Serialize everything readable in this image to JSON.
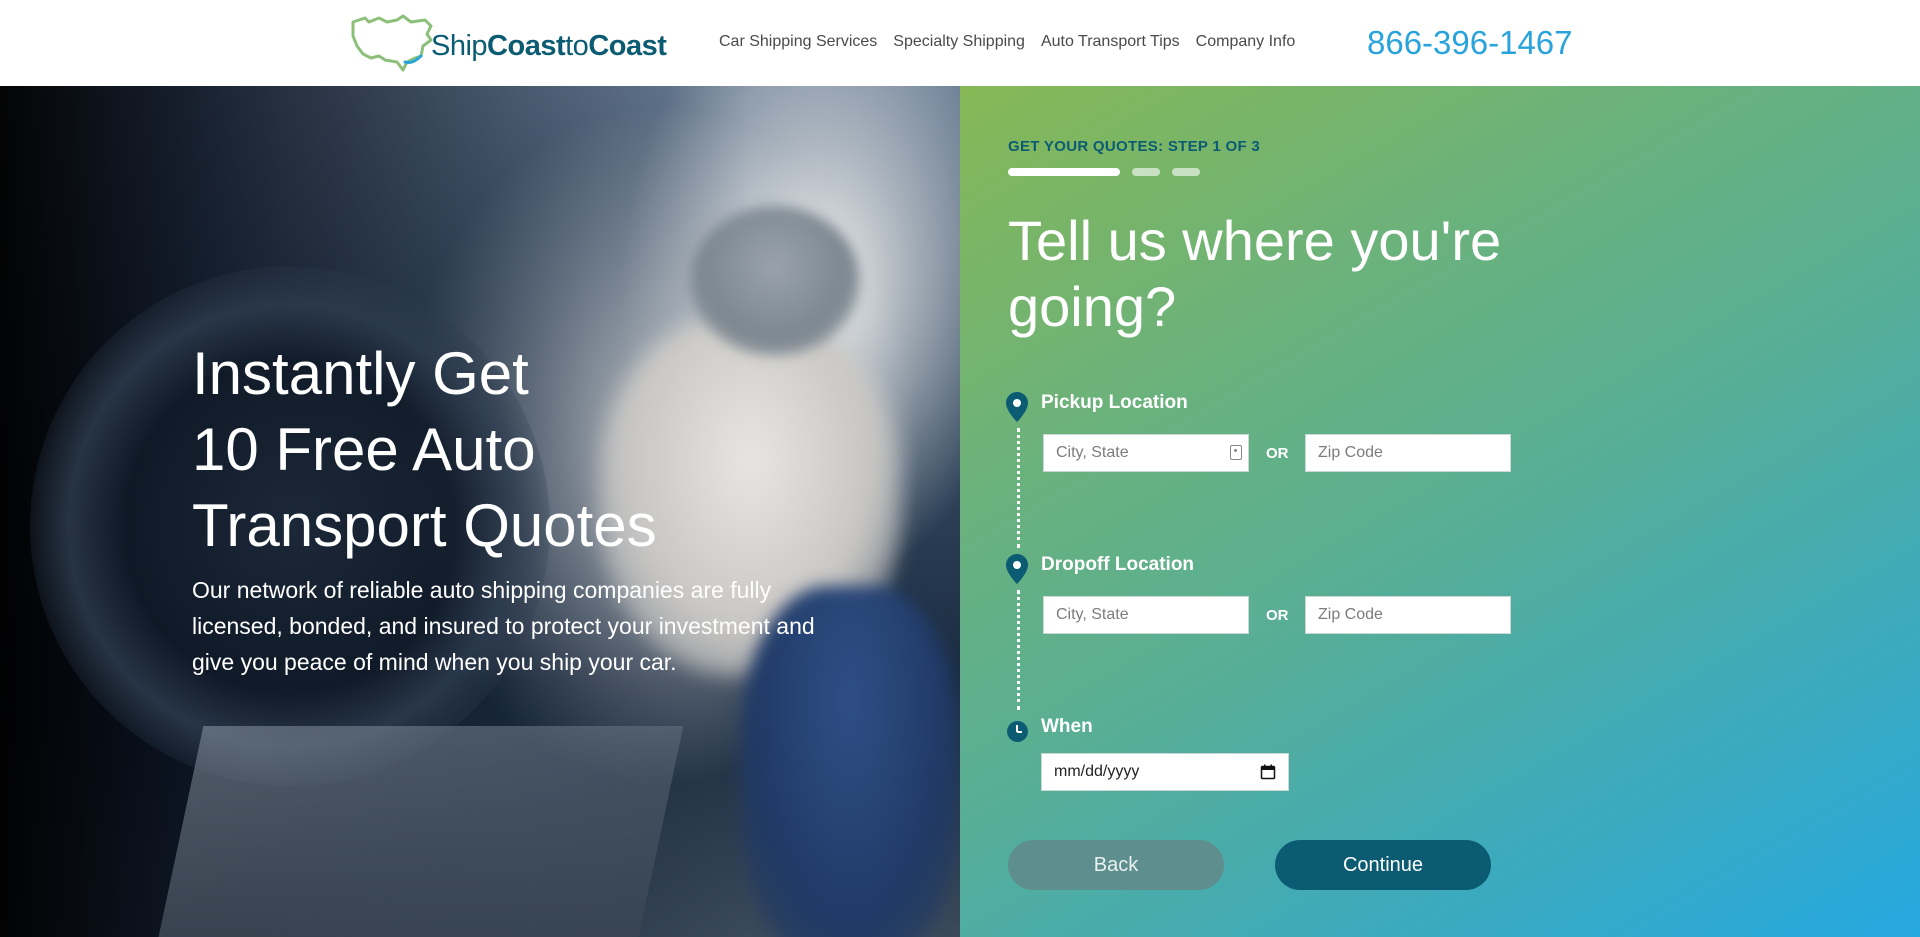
{
  "header": {
    "logo": {
      "text_ship": "Ship",
      "text_coast1": "Coast",
      "text_to": "to",
      "text_coast2": "Coast"
    },
    "nav": [
      {
        "label": "Car Shipping Services"
      },
      {
        "label": "Specialty Shipping"
      },
      {
        "label": "Auto Transport Tips"
      },
      {
        "label": "Company Info"
      }
    ],
    "phone": "866-396-1467"
  },
  "hero": {
    "title_lines": [
      "Instantly Get",
      "10 Free Auto",
      "Transport Quotes"
    ],
    "description": "Our network of reliable auto shipping companies are fully licensed, bonded, and insured to protect your investment and give you peace of mind when you ship your car."
  },
  "form": {
    "step_label": "GET YOUR QUOTES: STEP 1 OF 3",
    "progress": {
      "current_step": 1,
      "total_steps": 3
    },
    "title": "Tell us where you're going?",
    "pickup": {
      "label": "Pickup Location",
      "city_placeholder": "City, State",
      "or_label": "OR",
      "zip_placeholder": "Zip Code"
    },
    "dropoff": {
      "label": "Dropoff Location",
      "city_placeholder": "City, State",
      "or_label": "OR",
      "zip_placeholder": "Zip Code"
    },
    "when": {
      "label": "When",
      "date_placeholder": "mm/dd/yyyy"
    },
    "back_label": "Back",
    "continue_label": "Continue"
  },
  "icons": {
    "logo": "usa-map-logo-icon",
    "location": "map-pin-icon",
    "time": "clock-icon",
    "calendar": "calendar-icon",
    "autofill": "contact-card-icon"
  },
  "colors": {
    "brand_dark": "#0b5c72",
    "phone_blue": "#29a3dc",
    "gradient_start": "#86b856",
    "gradient_end": "#25a8e0",
    "back_button": "#5e8f8e"
  }
}
